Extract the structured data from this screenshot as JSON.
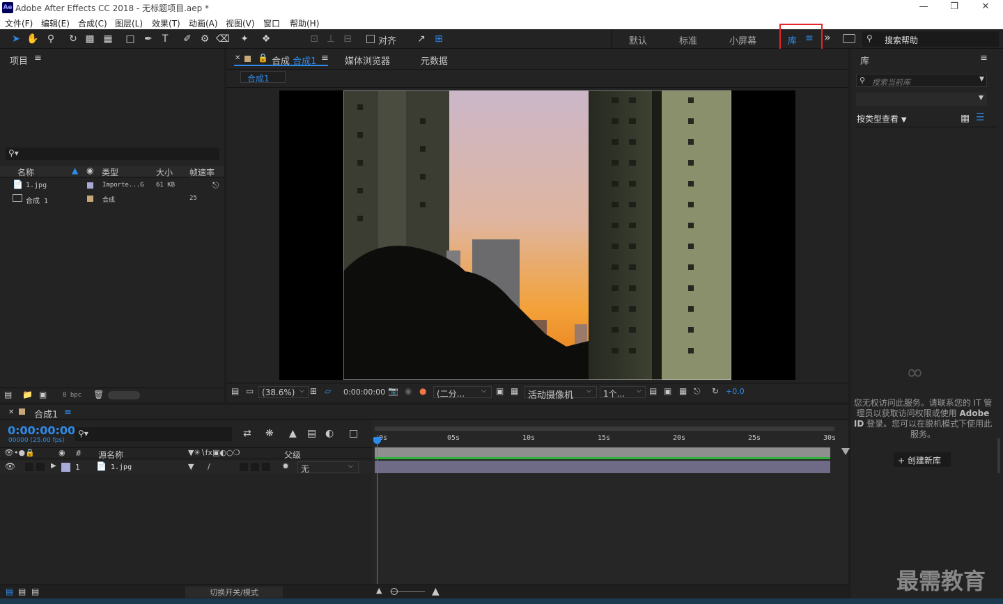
{
  "app": {
    "title": "Adobe After Effects CC 2018 - 无标题项目.aep *",
    "logo": "Ae"
  },
  "menu": [
    "文件(F)",
    "编辑(E)",
    "合成(C)",
    "图层(L)",
    "效果(T)",
    "动画(A)",
    "视图(V)",
    "窗口",
    "帮助(H)"
  ],
  "toolbar": {
    "align_label": "对齐",
    "workspaces": [
      "默认",
      "标准",
      "小屏幕"
    ],
    "library_tab": "库",
    "more": "»",
    "search_placeholder": "搜索帮助"
  },
  "project": {
    "title": "项目",
    "search_placeholder": "",
    "columns": [
      "名称",
      "类型",
      "大小",
      "帧速率"
    ],
    "rows": [
      {
        "name": "1.jpg",
        "type": "Importe...G",
        "size": "61 KB",
        "fps": "",
        "color": "#a9a9d9"
      },
      {
        "name": "合成 1",
        "type": "合成",
        "size": "",
        "fps": "25",
        "color": "#c8a878"
      }
    ],
    "bpc": "8 bpc"
  },
  "composition": {
    "tabs": [
      "合成 合成1",
      "媒体浏览器",
      "元数据"
    ],
    "comp_tab_prefix": "合成",
    "comp_tab_name": "合成1",
    "breadcrumb": "合成1",
    "zoom": "(38.6%)",
    "timecode": "0:00:00:00",
    "resolution": "(二分...",
    "camera": "活动摄像机",
    "views": "1个...",
    "exposure": "+0.0"
  },
  "timeline": {
    "tab": "合成1",
    "timecode": "0:00:00:00",
    "fps_info": "00000 (25.00 fps)",
    "col_source": "源名称",
    "col_parent": "父级",
    "ruler": [
      "0s",
      "05s",
      "10s",
      "15s",
      "20s",
      "25s",
      "30s"
    ],
    "layer": {
      "index": "1",
      "name": "1.jpg",
      "parent": "无",
      "color": "#a9a9d9"
    },
    "toggle_label": "切换开关/模式"
  },
  "library": {
    "title": "库",
    "search_placeholder": "搜索当前库",
    "view_by": "按类型查看",
    "message_prefix": "您无权访问此服务。请联系您的 IT 管理员以获取访问权限或使用 ",
    "message_brand": "Adobe ID",
    "message_suffix": " 登录。您可以在脱机模式下使用此服务。",
    "create_button": "+ 创建新库"
  },
  "watermark": "最需教育",
  "colors": {
    "accent": "#2d8ceb",
    "highlight_box": "#e5262a",
    "track_green": "#2fb33a"
  }
}
